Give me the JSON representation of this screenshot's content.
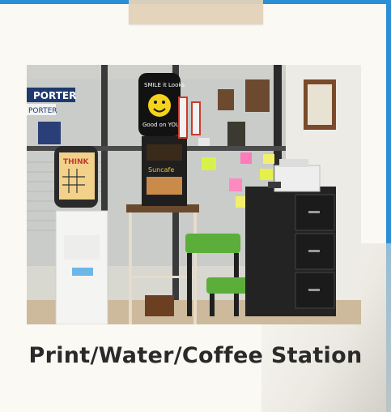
{
  "card": {
    "caption": "Print/Water/Coffee Station"
  },
  "photo": {
    "signs": {
      "porter_top": "PORTER",
      "porter_mid": "PORTER",
      "think": "THINK",
      "smile_line1": "SMILE it Looks",
      "smile_line2": "Good on YOU!!!",
      "suncafe": "Suncafe"
    }
  },
  "colors": {
    "frame_blue": "#2b8fd6",
    "card_bg": "#fbf9f4",
    "tape": "#e2d3b9",
    "caption_text": "#2a2a2a"
  }
}
